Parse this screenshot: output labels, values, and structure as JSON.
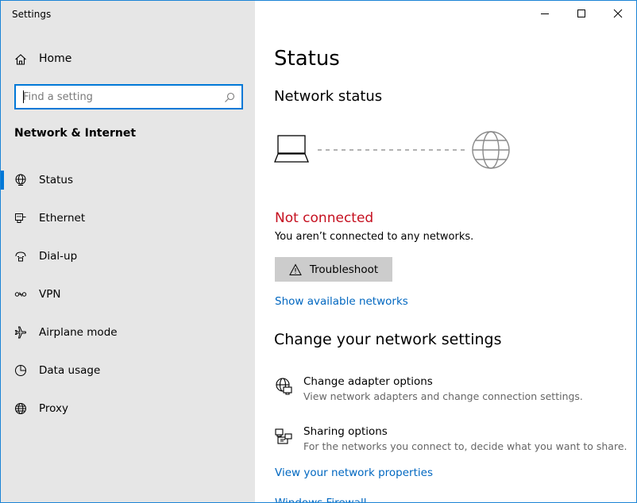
{
  "window": {
    "title": "Settings"
  },
  "sidebar": {
    "home_label": "Home",
    "search_placeholder": "Find a setting",
    "section_title": "Network & Internet",
    "items": [
      {
        "label": "Status",
        "icon": "globe-network-icon",
        "active": true
      },
      {
        "label": "Ethernet",
        "icon": "ethernet-icon",
        "active": false
      },
      {
        "label": "Dial-up",
        "icon": "dial-up-icon",
        "active": false
      },
      {
        "label": "VPN",
        "icon": "vpn-icon",
        "active": false
      },
      {
        "label": "Airplane mode",
        "icon": "airplane-icon",
        "active": false
      },
      {
        "label": "Data usage",
        "icon": "data-usage-icon",
        "active": false
      },
      {
        "label": "Proxy",
        "icon": "globe-icon",
        "active": false
      }
    ]
  },
  "main": {
    "page_title": "Status",
    "network_status_title": "Network status",
    "status_text": "Not connected",
    "status_description": "You aren’t connected to any networks.",
    "troubleshoot_label": "Troubleshoot",
    "show_networks_link": "Show available networks",
    "change_settings_title": "Change your network settings",
    "options": [
      {
        "title": "Change adapter options",
        "description": "View network adapters and change connection settings.",
        "icon": "adapter-icon"
      },
      {
        "title": "Sharing options",
        "description": "For the networks you connect to, decide what you want to share.",
        "icon": "sharing-icon"
      }
    ],
    "view_properties_link": "View your network properties",
    "firewall_link": "Windows Firewall"
  },
  "colors": {
    "accent": "#0078d7",
    "link": "#0067c0",
    "error": "#c50f1f",
    "sidebar_bg": "#e6e6e6",
    "button_bg": "#cccccc"
  }
}
